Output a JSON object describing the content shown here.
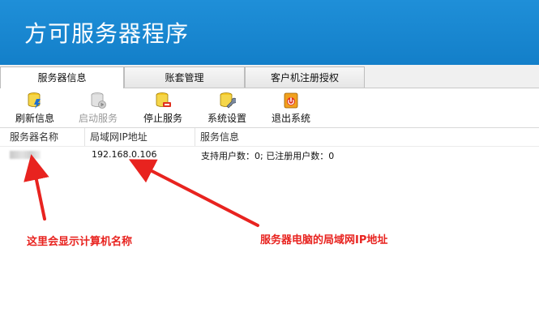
{
  "app": {
    "title": "方可服务器程序"
  },
  "tabs": [
    {
      "label": "服务器信息",
      "active": true
    },
    {
      "label": "账套管理",
      "active": false
    },
    {
      "label": "客户机注册授权",
      "active": false
    }
  ],
  "toolbar": {
    "refresh_label": "刷新信息",
    "start_label": "启动服务",
    "start_enabled": false,
    "stop_label": "停止服务",
    "settings_label": "系统设置",
    "exit_label": "退出系统"
  },
  "list": {
    "columns": [
      "服务器名称",
      "局域网IP地址",
      "服务信息"
    ],
    "rows": [
      {
        "server_name": "",
        "ip": "192.168.0.106",
        "service_info": "支持用户数：0; 已注册用户数：0"
      }
    ]
  },
  "annotations": {
    "left": "这里会显示计算机名称",
    "right": "服务器电脑的局域网IP地址",
    "color": "#e8231f"
  },
  "colors": {
    "header": "#1a88d2"
  }
}
